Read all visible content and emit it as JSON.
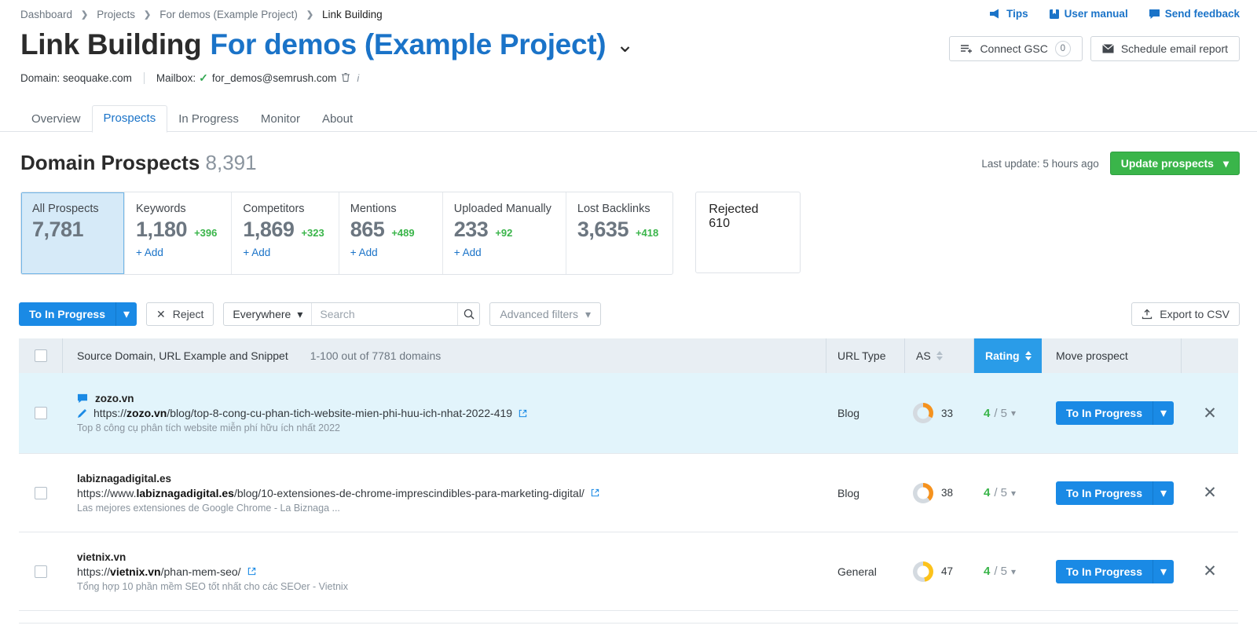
{
  "breadcrumb": [
    {
      "label": "Dashboard"
    },
    {
      "label": "Projects"
    },
    {
      "label": "For demos (Example Project)"
    },
    {
      "label": "Link Building"
    }
  ],
  "top_links": [
    {
      "label": "Tips",
      "icon": "megaphone-icon"
    },
    {
      "label": "User manual",
      "icon": "book-icon"
    },
    {
      "label": "Send feedback",
      "icon": "chat-icon"
    }
  ],
  "header": {
    "title_main": "Link Building",
    "title_project": "For demos (Example Project)",
    "chevron": "⌄",
    "domain_label": "Domain: seoquake.com",
    "mailbox_label": "Mailbox:",
    "mailbox_check": "✓",
    "mailbox_value": "for_demos@semrush.com",
    "connect_gsc_label": "Connect GSC",
    "connect_gsc_count": "0",
    "schedule_label": "Schedule email report"
  },
  "tabs": [
    {
      "label": "Overview",
      "active": false
    },
    {
      "label": "Prospects",
      "active": true
    },
    {
      "label": "In Progress",
      "active": false
    },
    {
      "label": "Monitor",
      "active": false
    },
    {
      "label": "About",
      "active": false
    }
  ],
  "section": {
    "title": "Domain Prospects",
    "count": "8,391",
    "last_update": "Last update: 5 hours ago",
    "update_button": "Update prospects"
  },
  "cards": [
    {
      "label": "All Prospects",
      "value": "7,781",
      "delta": "",
      "add": "",
      "selected": true
    },
    {
      "label": "Keywords",
      "value": "1,180",
      "delta": "+396",
      "add": "+ Add",
      "selected": false
    },
    {
      "label": "Competitors",
      "value": "1,869",
      "delta": "+323",
      "add": "+ Add",
      "selected": false
    },
    {
      "label": "Mentions",
      "value": "865",
      "delta": "+489",
      "add": "+ Add",
      "selected": false
    },
    {
      "label": "Uploaded Manually",
      "value": "233",
      "delta": "+92",
      "add": "+ Add",
      "selected": false
    },
    {
      "label": "Lost Backlinks",
      "value": "3,635",
      "delta": "+418",
      "add": "",
      "selected": false
    }
  ],
  "card_rejected": {
    "label": "Rejected",
    "value": "610"
  },
  "toolbar": {
    "to_in_progress": "To In Progress",
    "reject": "Reject",
    "scope_selected": "Everywhere",
    "search_placeholder": "Search",
    "search_value": "",
    "advanced_filters": "Advanced filters",
    "export_csv": "Export to CSV"
  },
  "table": {
    "columns": {
      "source": "Source Domain, URL Example and Snippet",
      "source_meta": "1-100 out of 7781 domains",
      "url_type": "URL Type",
      "as": "AS",
      "rating": "Rating",
      "move": "Move prospect"
    },
    "rows": [
      {
        "domain": "zozo.vn",
        "url_prefix": "https://",
        "url_domain": "zozo.vn",
        "url_path": "/blog/top-8-cong-cu-phan-tich-website-mien-phi-huu-ich-nhat-2022-419",
        "snippet": "Top 8 công cụ phân tích website miễn phí hữu ích nhất 2022",
        "url_type": "Blog",
        "as_value": "33",
        "as_color": "#f5921e",
        "rating_num": "4",
        "rating_den": "/ 5",
        "move_label": "To In Progress",
        "has_comment_icon": true,
        "has_pencil_icon": true,
        "highlighted": true
      },
      {
        "domain": "labiznagadigital.es",
        "url_prefix": "https://www.",
        "url_domain": "labiznagadigital.es",
        "url_path": "/blog/10-extensiones-de-chrome-imprescindibles-para-marketing-digital/",
        "snippet": "Las mejores extensiones de Google Chrome - La Biznaga ...",
        "url_type": "Blog",
        "as_value": "38",
        "as_color": "#f5921e",
        "rating_num": "4",
        "rating_den": "/ 5",
        "move_label": "To In Progress",
        "has_comment_icon": false,
        "has_pencil_icon": false,
        "highlighted": false
      },
      {
        "domain": "vietnix.vn",
        "url_prefix": "https://",
        "url_domain": "vietnix.vn",
        "url_path": "/phan-mem-seo/",
        "snippet": "Tổng hợp 10 phần mềm SEO tốt nhất cho các SEOer - Vietnix",
        "url_type": "General",
        "as_value": "47",
        "as_color": "#fcc21b",
        "rating_num": "4",
        "rating_den": "/ 5",
        "move_label": "To In Progress",
        "has_comment_icon": false,
        "has_pencil_icon": false,
        "highlighted": false
      }
    ]
  },
  "colors": {
    "brand_blue": "#1a73c8",
    "action_blue": "#1a8ae5",
    "header_blue": "#2a9ce8",
    "green": "#3ab54a",
    "row_highlight": "#e2f4fb",
    "card_selected": "#d6eaf8",
    "thead_bg": "#e8eef3"
  }
}
